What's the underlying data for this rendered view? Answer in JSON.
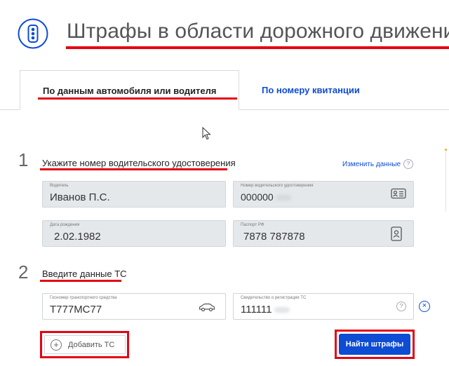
{
  "header": {
    "title": "Штрафы в области дорожного движения",
    "logo_icon": "traffic-light-icon",
    "accent_color": "#0d4cd3",
    "highlight_color": "#e30613"
  },
  "tabs": [
    {
      "label": "По данным автомобиля или водителя",
      "active": true
    },
    {
      "label": "По номеру квитанции",
      "active": false
    }
  ],
  "step1": {
    "number": "1",
    "title": "Укажите номер водительского удостоверения",
    "edit_link": "Изменить данные",
    "help": "?",
    "fields": {
      "driver": {
        "label": "Водитель",
        "value": "Иванов П.С."
      },
      "license": {
        "label": "Номер водительского удостоверения",
        "value": "000000",
        "icon": "id-card-icon"
      },
      "dob": {
        "label": "Дата рождения",
        "value": "2.02.1982"
      },
      "passport": {
        "label": "Паспорт РФ",
        "value": "7878 787878",
        "icon": "passport-icon"
      }
    }
  },
  "step2": {
    "number": "2",
    "title": "Введите данные ТС",
    "fields": {
      "plate": {
        "label": "Госномер транспортного средства",
        "value": "Т777МС77",
        "icon": "car-icon"
      },
      "cert": {
        "label": "Свидетельство о регистрации ТС",
        "value": "111111",
        "help": "?"
      }
    },
    "remove_icon": "×"
  },
  "buttons": {
    "add_vehicle": "Добавить ТС",
    "add_icon": "+",
    "find_fines": "Найти штрафы"
  }
}
